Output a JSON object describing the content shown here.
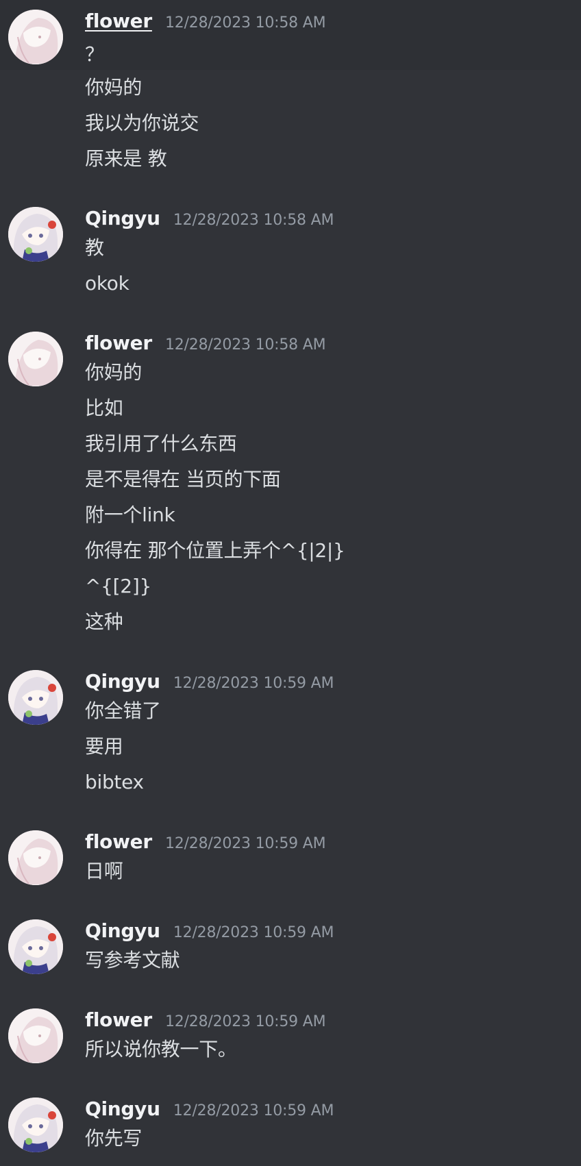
{
  "messages": [
    {
      "user": "flower",
      "timestamp": "12/28/2023 10:58 AM",
      "lines": [
        "？",
        "你妈的",
        "我以为你说交",
        "原来是 教"
      ]
    },
    {
      "user": "Qingyu",
      "timestamp": "12/28/2023 10:58 AM",
      "lines": [
        "教",
        "okok"
      ]
    },
    {
      "user": "flower",
      "timestamp": "12/28/2023 10:58 AM",
      "lines": [
        "你妈的",
        "比如",
        "我引用了什么东西",
        "是不是得在 当页的下面",
        "附一个link",
        "你得在 那个位置上弄个^{|2|}",
        "^{[2]}",
        "这种"
      ]
    },
    {
      "user": "Qingyu",
      "timestamp": "12/28/2023 10:59 AM",
      "lines": [
        "你全错了",
        "要用",
        "bibtex"
      ]
    },
    {
      "user": "flower",
      "timestamp": "12/28/2023 10:59 AM",
      "lines": [
        "日啊"
      ]
    },
    {
      "user": "Qingyu",
      "timestamp": "12/28/2023 10:59 AM",
      "lines": [
        "写参考文献"
      ]
    },
    {
      "user": "flower",
      "timestamp": "12/28/2023 10:59 AM",
      "lines": [
        "所以说你教一下。"
      ]
    },
    {
      "user": "Qingyu",
      "timestamp": "12/28/2023 10:59 AM",
      "lines": [
        "你先写"
      ]
    }
  ],
  "colors": {
    "background": "#313338",
    "hover_background": "#2e3035",
    "username": "#f2f3f5",
    "timestamp": "#949ba4",
    "message_text": "#dbdee1"
  }
}
